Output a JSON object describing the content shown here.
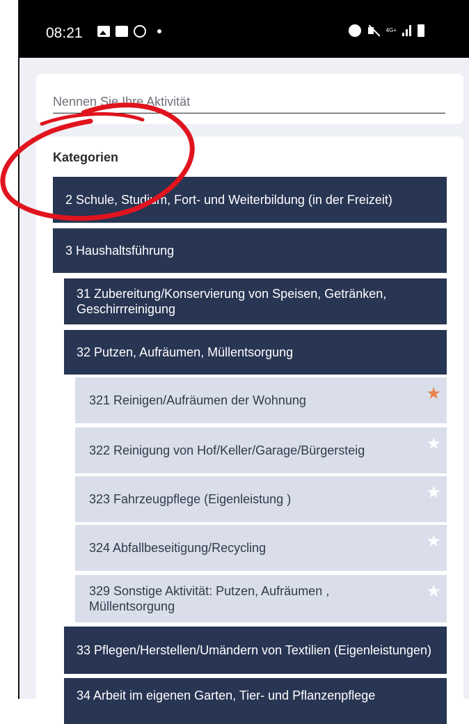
{
  "status_bar": {
    "time": "08:21",
    "icons_left": [
      "gallery-icon",
      "message-icon",
      "fan-icon",
      "dot-icon"
    ],
    "icons_right": [
      "alarm-icon",
      "mute-icon",
      "network-4g-icon",
      "signal-icon",
      "battery-icon"
    ],
    "network_label": "4G+"
  },
  "search": {
    "placeholder": "Nennen Sie Ihre Aktivität",
    "value": ""
  },
  "categories": {
    "title": "Kategorien",
    "items": [
      {
        "label": "2 Schule, Studium, Fort- und Weiterbildung (in der Freizeit)",
        "level": 1
      },
      {
        "label": "3 Haushaltsführung",
        "level": 1
      },
      {
        "label": "31 Zubereitung/Konservierung von Speisen, Getränken, Geschirrreinigung",
        "level": 2
      },
      {
        "label": "32 Putzen, Aufräumen, Müllentsorgung",
        "level": 2
      },
      {
        "label": "321 Reinigen/Aufräumen der Wohnung",
        "level": 3,
        "favorite": true
      },
      {
        "label": "322 Reinigung von Hof/Keller/Garage/Bürgersteig",
        "level": 3,
        "favorite": false
      },
      {
        "label": "323 Fahrzeugpflege (Eigenleistung )",
        "level": 3,
        "favorite": false
      },
      {
        "label": "324 Abfallbeseitigung/Recycling",
        "level": 3,
        "favorite": false
      },
      {
        "label": "329 Sonstige Aktivität: Putzen, Aufräumen , Müllentsorgung",
        "level": 3,
        "favorite": false
      },
      {
        "label": "33 Pflegen/Herstellen/Umändern von Textilien (Eigenleistungen)",
        "level": 2
      },
      {
        "label": "34 Arbeit im eigenen Garten, Tier- und Pflanzenpflege",
        "level": 2
      }
    ]
  },
  "star_glyph": "★",
  "colors": {
    "dark_row": "#283553",
    "light_row": "#d9deea",
    "star_active": "#e8824a",
    "star_inactive": "#ffffff",
    "annotation": "#e0141e"
  }
}
